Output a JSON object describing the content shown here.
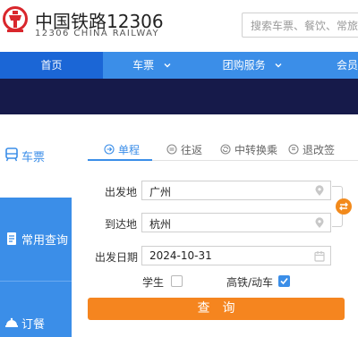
{
  "header": {
    "site_name": "中国铁路12306",
    "site_name_en": "12306 CHINA RAILWAY",
    "search_placeholder": "搜索车票、餐饮、常旅客"
  },
  "nav": {
    "items": [
      {
        "label": "首页",
        "active": true
      },
      {
        "label": "车票",
        "has_dropdown": true
      },
      {
        "label": "团购服务",
        "has_dropdown": true
      },
      {
        "label": "会员"
      }
    ]
  },
  "sidebar": {
    "items": [
      {
        "label": "车票",
        "icon": "train-icon",
        "active": true
      },
      {
        "label": "常用查询",
        "icon": "document-icon"
      },
      {
        "label": "订餐",
        "icon": "food-icon"
      }
    ]
  },
  "tabs": [
    {
      "label": "单程",
      "icon": "arrow-right-circle-icon",
      "active": true
    },
    {
      "label": "往返",
      "icon": "round-trip-icon"
    },
    {
      "label": "中转换乘",
      "icon": "transfer-icon"
    },
    {
      "label": "退改签",
      "icon": "refund-icon"
    }
  ],
  "form": {
    "from_label": "出发地",
    "from_value": "广州",
    "to_label": "到达地",
    "to_value": "杭州",
    "date_label": "出发日期",
    "date_value": "2024-10-31",
    "student_label": "学生",
    "student_checked": false,
    "highspeed_label": "高铁/动车",
    "highspeed_checked": true,
    "query_label": "查询"
  },
  "colors": {
    "primary": "#3b8ee8",
    "nav_active": "#1b66d6",
    "accent": "#f5851f",
    "logo_red": "#d9262c",
    "banner": "#161a4a"
  }
}
